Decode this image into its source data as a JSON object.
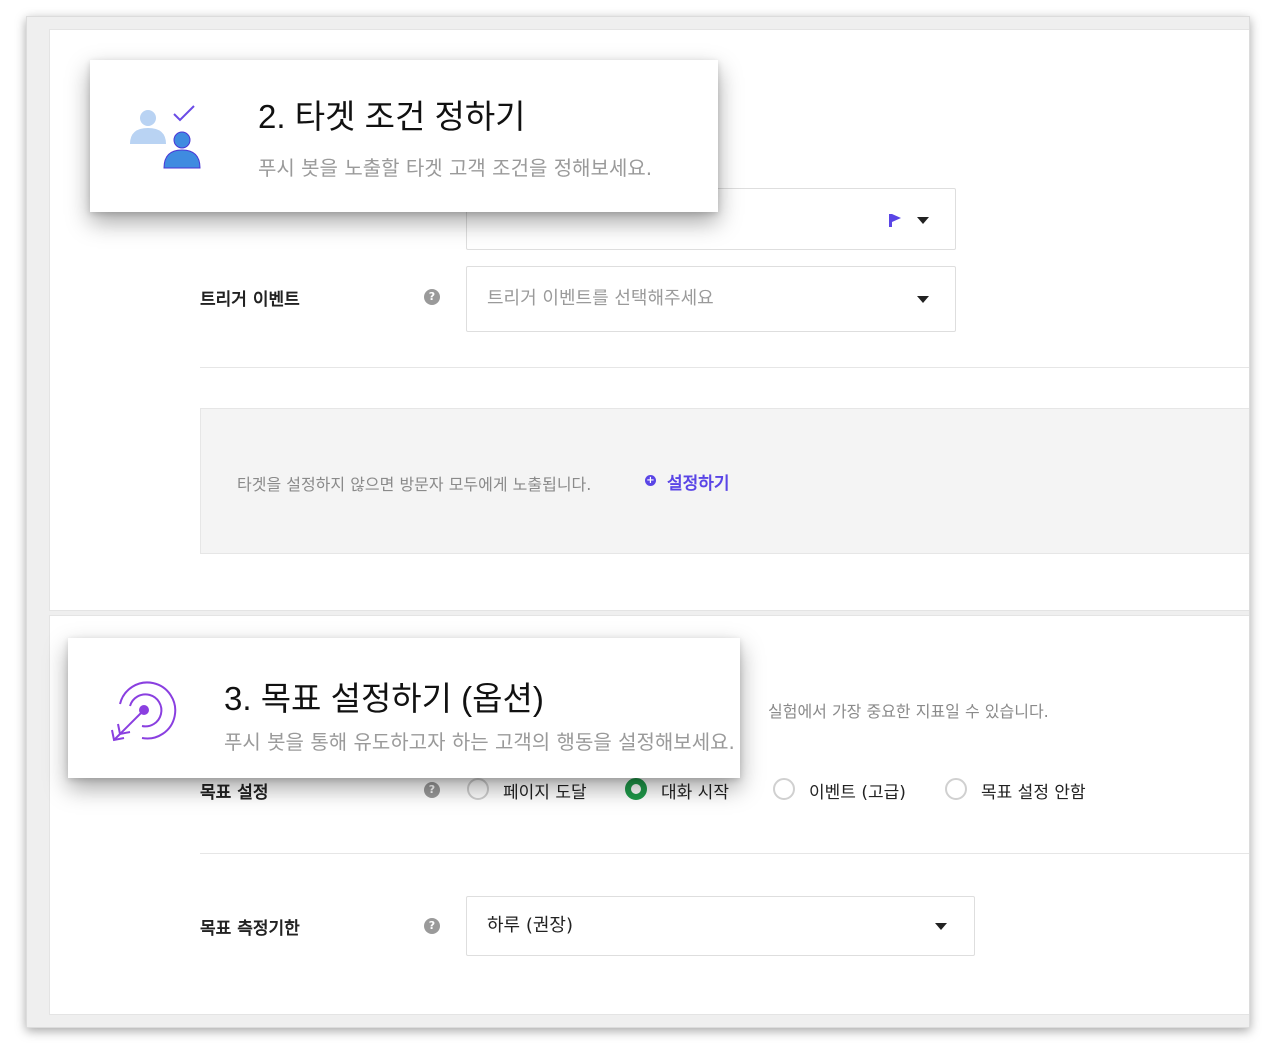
{
  "target_section": {
    "callout_title": "2. 타겟 조건 정하기",
    "callout_subtitle": "푸시 봇을 노출할 타겟 고객 조건을 정해보세요.",
    "trigger_event": {
      "label": "트리거 이벤트",
      "help_icon": "?",
      "placeholder": "트리거 이벤트를 선택해주세요"
    },
    "notice": {
      "message": "타겟을 설정하지 않으면 방문자 모두에게 노출됩니다.",
      "link": "설정하기",
      "link_icon": "plus-circle-icon"
    },
    "accent_color": "#5a45e6"
  },
  "goal_section": {
    "callout_title": "3. 목표 설정하기 (옵션)",
    "callout_subtitle": "푸시 봇을 통해 유도하고자 하는 고객의 행동을 설정해보세요.",
    "description_tail": "실험에서 가장 중요한 지표일 수 있습니다.",
    "goal_setting": {
      "label": "목표 설정",
      "help_icon": "?",
      "options": [
        {
          "label": "페이지 도달",
          "selected": false
        },
        {
          "label": "대화 시작",
          "selected": true
        },
        {
          "label": "이벤트 (고급)",
          "selected": false
        },
        {
          "label": "목표 설정 안함",
          "selected": false
        }
      ]
    },
    "measure_period": {
      "label": "목표 측정기한",
      "help_icon": "?",
      "value": "하루 (권장)"
    },
    "selected_color": "#1f9a4a"
  }
}
